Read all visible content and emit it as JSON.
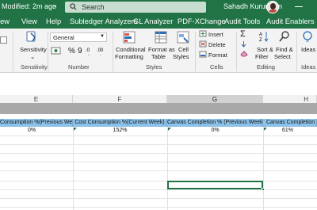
{
  "titlebar": {
    "modified": "Modified: 2m ago",
    "search_placeholder": "Search",
    "user_name": "Sahadh Kuruniyan"
  },
  "menu": [
    "iew",
    "Help",
    "Subledger Analyzers",
    "GL Analyzer",
    "PDF-XChange",
    "Audit Tools",
    "Audit Enablers"
  ],
  "ribbon": {
    "sensitivity": "Sensitivity",
    "number_format": "General",
    "percent_symbol": "%",
    "comma_symbol": "9",
    "conditional": [
      "Conditional",
      "Formatting"
    ],
    "format_as": [
      "Format as",
      "Table"
    ],
    "cell_styles": [
      "Cell",
      "Styles"
    ],
    "insert": "Insert",
    "delete": "Delete",
    "format": "Format",
    "sort": [
      "Sort &",
      "Filter"
    ],
    "find": [
      "Find &",
      "Select"
    ],
    "ideas": "Ideas",
    "groups": {
      "sensitivity": "Sensitivity",
      "number": "Number",
      "styles": "Styles",
      "cells": "Cells",
      "editing": "Editing",
      "ideas": "Ideas"
    }
  },
  "columns": [
    "E",
    "F",
    "G",
    "H"
  ],
  "headers": [
    "Consumption %(Previous Week)",
    "Cost Consumption %(Current Week)",
    "Canvas Completion % (Previous Week)",
    "Canvas Completion % (C"
  ],
  "values": [
    "0%",
    "152%",
    "0%",
    "61%"
  ],
  "colors": {
    "accent": "#217346",
    "header_fill": "#8cc2e9"
  }
}
